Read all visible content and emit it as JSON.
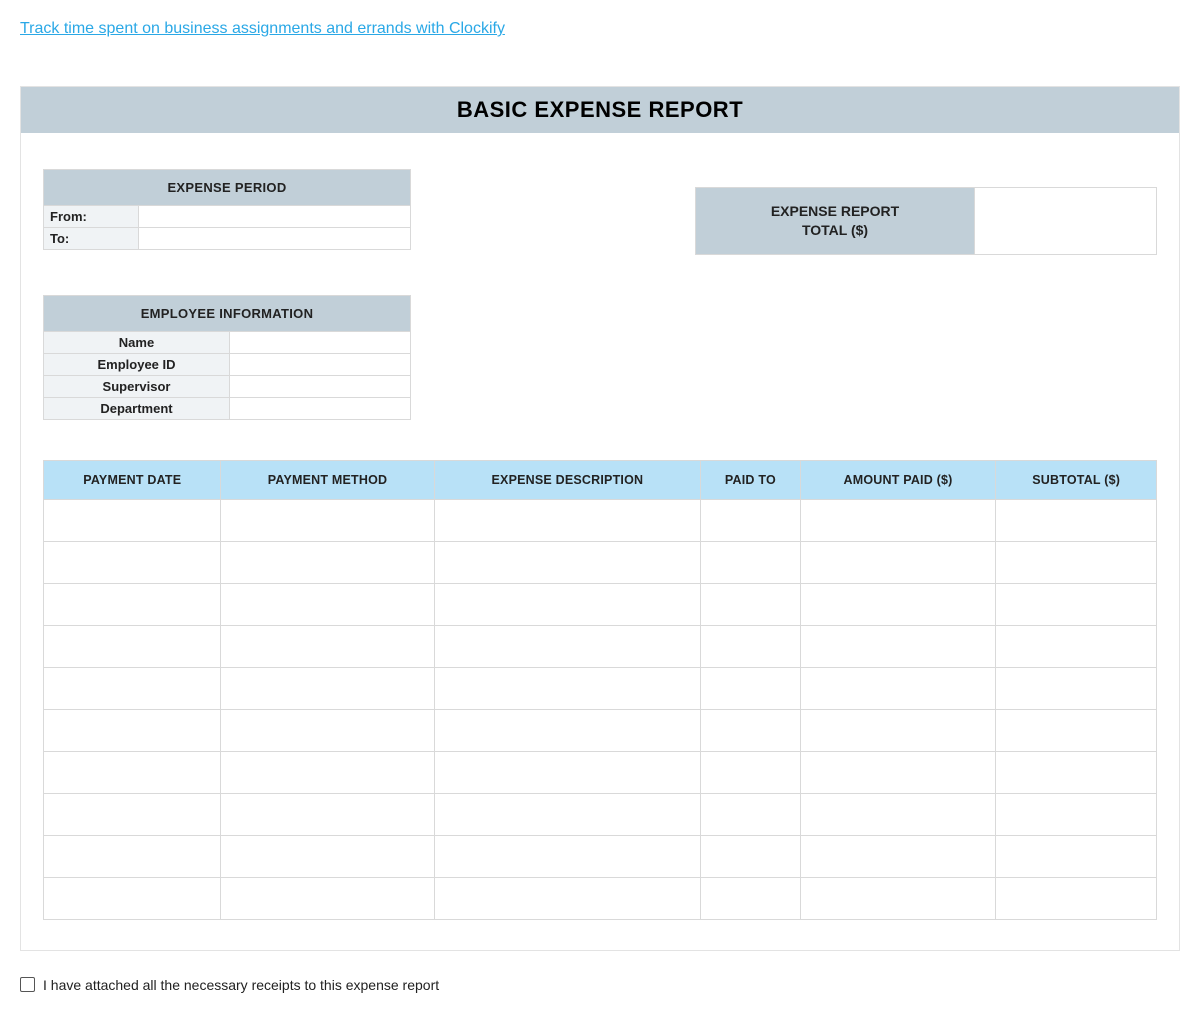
{
  "top_link": "Track time spent on business assignments and errands with Clockify",
  "title": "BASIC EXPENSE REPORT",
  "expense_period": {
    "header": "EXPENSE PERIOD",
    "from_label": "From:",
    "from_value": "",
    "to_label": "To:",
    "to_value": ""
  },
  "total_box": {
    "line1": "EXPENSE REPORT",
    "line2": "TOTAL ($)",
    "value": ""
  },
  "employee": {
    "header": "EMPLOYEE INFORMATION",
    "rows": [
      {
        "label": "Name",
        "value": ""
      },
      {
        "label": "Employee ID",
        "value": ""
      },
      {
        "label": "Supervisor",
        "value": ""
      },
      {
        "label": "Department",
        "value": ""
      }
    ]
  },
  "columns": [
    "PAYMENT DATE",
    "PAYMENT METHOD",
    "EXPENSE DESCRIPTION",
    "PAID TO",
    "AMOUNT PAID ($)",
    "SUBTOTAL ($)"
  ],
  "row_count": 10,
  "checkbox_label": "I have attached all the necessary receipts to this expense report",
  "checkbox_checked": false
}
